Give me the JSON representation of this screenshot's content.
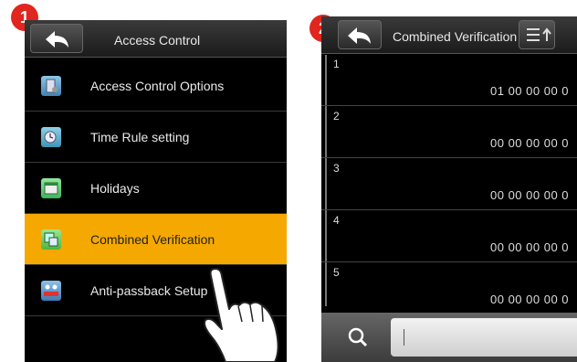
{
  "step_badges": [
    "1",
    "2"
  ],
  "screen1": {
    "title": "Access Control",
    "menu": [
      {
        "label": "Access Control Options",
        "icon": "door-settings-icon",
        "selected": false
      },
      {
        "label": "Time Rule setting",
        "icon": "clock-icon",
        "selected": false
      },
      {
        "label": "Holidays",
        "icon": "calendar-icon",
        "selected": false
      },
      {
        "label": "Combined Verification",
        "icon": "group-verify-icon",
        "selected": true
      },
      {
        "label": "Anti-passback Setup",
        "icon": "anti-passback-icon",
        "selected": false
      }
    ]
  },
  "screen2": {
    "title": "Combined Verification",
    "rows": [
      {
        "index": "1",
        "value": "01 00 00 00 0"
      },
      {
        "index": "2",
        "value": "00 00 00 00 0"
      },
      {
        "index": "3",
        "value": "00 00 00 00 0"
      },
      {
        "index": "4",
        "value": "00 00 00 00 0"
      },
      {
        "index": "5",
        "value": "00 00 00 00 0"
      }
    ],
    "search_value": ""
  },
  "colors": {
    "selected": "#f5a800",
    "badge": "#e0261e",
    "screen_bg": "#000000"
  }
}
